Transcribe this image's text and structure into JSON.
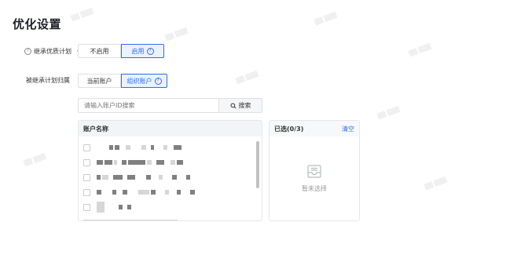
{
  "page": {
    "title": "优化设置"
  },
  "inherit_plan": {
    "label": "继承优质计划",
    "options": [
      {
        "label": "不启用",
        "active": false
      },
      {
        "label": "启用",
        "active": true
      }
    ]
  },
  "inherited_owner": {
    "label": "被继承计划归属",
    "options": [
      {
        "label": "当前账户",
        "active": false
      },
      {
        "label": "组织账户",
        "active": true
      }
    ]
  },
  "search": {
    "placeholder": "请输入账户ID搜索",
    "button_label": "搜索"
  },
  "account_list": {
    "header": "账户名称"
  },
  "selected": {
    "header": "已选(0/3)",
    "clear_label": "清空",
    "empty_text": "暂未选择"
  },
  "colors": {
    "accent": "#2e6fe8",
    "required": "#f23c3c"
  },
  "icons": {
    "help": "question-circle-icon",
    "search": "search-icon",
    "empty": "inbox-empty-icon"
  }
}
